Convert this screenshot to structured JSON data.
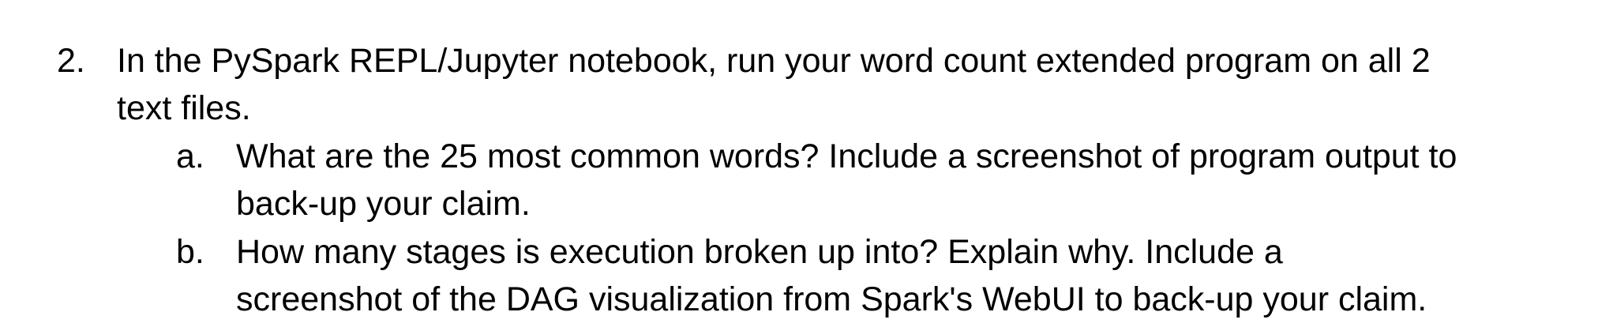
{
  "item": {
    "number": "2.",
    "text_line1": "In the PySpark REPL/Jupyter notebook, run your word count extended program on all 2",
    "text_line2": "text files.",
    "subitems": [
      {
        "marker": "a.",
        "line1": "What are the 25 most common words? Include a screenshot of program output to",
        "line2": "back-up your claim."
      },
      {
        "marker": "b.",
        "line1": "How many stages is execution broken up into? Explain why. Include a",
        "line2": "screenshot of the DAG visualization from Spark's WebUI to back-up your claim."
      }
    ]
  }
}
